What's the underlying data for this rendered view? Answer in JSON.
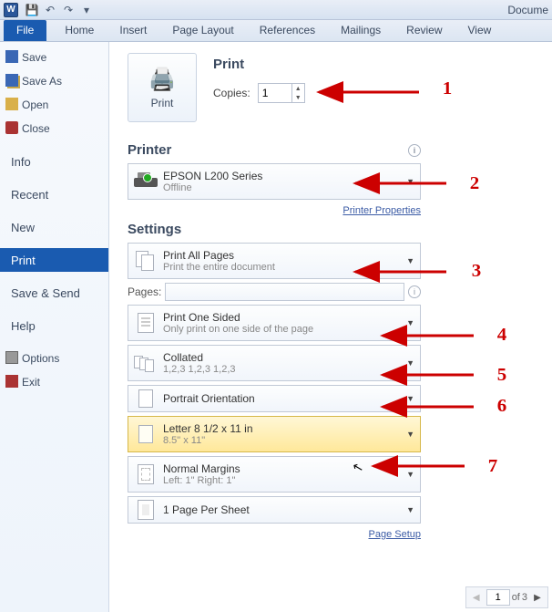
{
  "titlebar": {
    "doc_title": "Docume"
  },
  "ribbon": {
    "file": "File",
    "tabs": [
      "Home",
      "Insert",
      "Page Layout",
      "References",
      "Mailings",
      "Review",
      "View"
    ]
  },
  "sidebar": {
    "quick": [
      {
        "label": "Save",
        "icon": "save-icon"
      },
      {
        "label": "Save As",
        "icon": "save-as-icon"
      },
      {
        "label": "Open",
        "icon": "open-icon"
      },
      {
        "label": "Close",
        "icon": "close-icon"
      }
    ],
    "main": [
      {
        "label": "Info"
      },
      {
        "label": "Recent"
      },
      {
        "label": "New"
      },
      {
        "label": "Print",
        "selected": true
      },
      {
        "label": "Save & Send"
      },
      {
        "label": "Help"
      }
    ],
    "footer": [
      {
        "label": "Options",
        "icon": "options-icon"
      },
      {
        "label": "Exit",
        "icon": "exit-icon"
      }
    ]
  },
  "print": {
    "title": "Print",
    "button_label": "Print",
    "copies_label": "Copies:",
    "copies_value": "1"
  },
  "printer": {
    "title": "Printer",
    "name": "EPSON L200 Series",
    "status": "Offline",
    "properties_link": "Printer Properties"
  },
  "settings": {
    "title": "Settings",
    "range": {
      "t1": "Print All Pages",
      "t2": "Print the entire document"
    },
    "pages_label": "Pages:",
    "pages_value": "",
    "sides": {
      "t1": "Print One Sided",
      "t2": "Only print on one side of the page"
    },
    "collate": {
      "t1": "Collated",
      "t2": "1,2,3   1,2,3   1,2,3"
    },
    "orient": {
      "t1": "Portrait Orientation"
    },
    "paper": {
      "t1": "Letter 8 1/2 x 11 in",
      "t2": "8.5\" x 11\""
    },
    "margins": {
      "t1": "Normal Margins",
      "t2": "Left: 1\"   Right: 1\""
    },
    "ppp": {
      "t1": "1 Page Per Sheet"
    },
    "page_setup_link": "Page Setup"
  },
  "pagenav": {
    "current": "1",
    "of_label": "of",
    "total": "3"
  },
  "annotations": {
    "n1": "1",
    "n2": "2",
    "n3": "3",
    "n4": "4",
    "n5": "5",
    "n6": "6",
    "n7": "7"
  }
}
